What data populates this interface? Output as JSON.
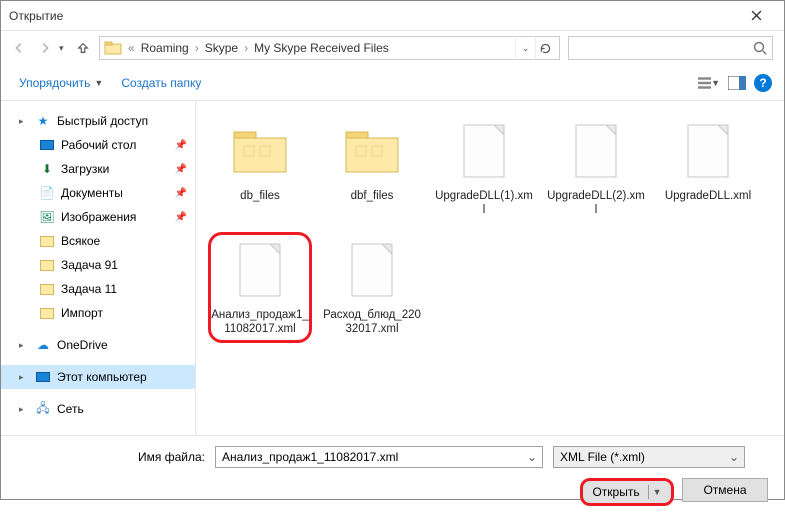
{
  "window": {
    "title": "Открытие"
  },
  "breadcrumb": {
    "prefix": "«",
    "items": [
      "Roaming",
      "Skype",
      "My Skype Received Files"
    ]
  },
  "search": {
    "placeholder": ""
  },
  "toolbar": {
    "organize": "Упорядочить",
    "new_folder": "Создать папку"
  },
  "sidebar": {
    "quick": "Быстрый доступ",
    "desktop": "Рабочий стол",
    "downloads": "Загрузки",
    "documents": "Документы",
    "pictures": "Изображения",
    "folders": [
      "Всякое",
      "Задача 91",
      "Задача 11",
      "Импорт"
    ],
    "onedrive": "OneDrive",
    "thispc": "Этот компьютер",
    "network": "Сеть"
  },
  "files": [
    {
      "name": "db_files",
      "type": "folder"
    },
    {
      "name": "dbf_files",
      "type": "folder"
    },
    {
      "name": "UpgradeDLL(1).xml",
      "type": "file"
    },
    {
      "name": "UpgradeDLL(2).xml",
      "type": "file"
    },
    {
      "name": "UpgradeDLL.xml",
      "type": "file"
    },
    {
      "name": "Анализ_продаж1_11082017.xml",
      "type": "file",
      "highlighted": true
    },
    {
      "name": "Расход_блюд_22032017.xml",
      "type": "file"
    }
  ],
  "footer": {
    "filename_label": "Имя файла:",
    "filename_value": "Анализ_продаж1_11082017.xml",
    "filetype_value": "XML File (*.xml)",
    "open": "Открыть",
    "cancel": "Отмена"
  }
}
